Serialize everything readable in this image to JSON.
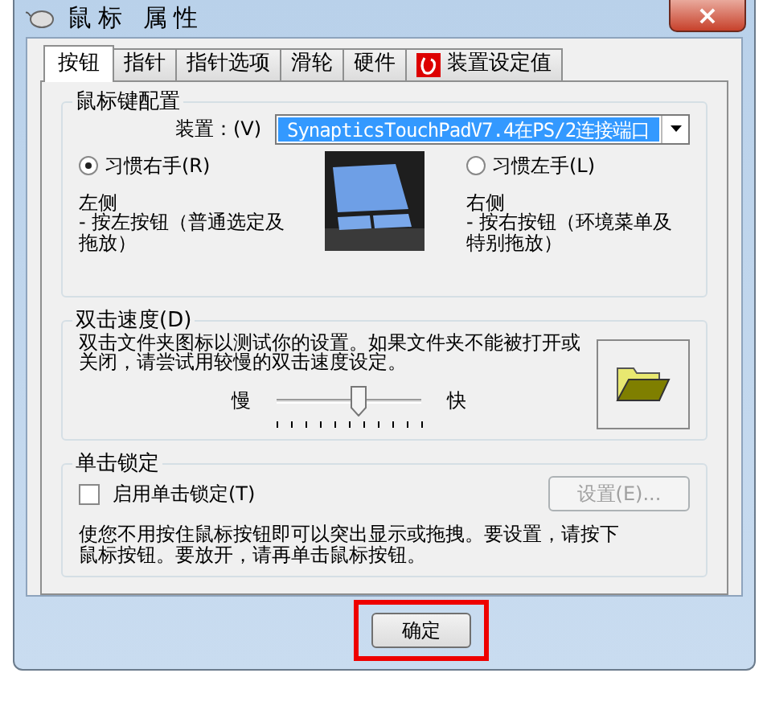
{
  "window": {
    "title": "鼠标 属性",
    "close": "×"
  },
  "tabs": [
    {
      "label": "按钮",
      "selected": true
    },
    {
      "label": "指针",
      "selected": false
    },
    {
      "label": "指针选项",
      "selected": false
    },
    {
      "label": "滑轮",
      "selected": false
    },
    {
      "label": "硬件",
      "selected": false
    },
    {
      "label": "装置设定值",
      "selected": false,
      "kind": "icon"
    }
  ],
  "button_config": {
    "title": "鼠标键配置",
    "device_label": "装置：(V)",
    "device_value": "SynapticsTouchPadV7.4在PS/2连接端口",
    "options": [
      {
        "label": "习惯右手(R)",
        "selected": true,
        "side": "左侧",
        "description": " - 按左按钮（普通选定及拖放）"
      },
      {
        "label": "习惯左手(L)",
        "selected": false,
        "side": "右侧",
        "description": " - 按右按钮（环境菜单及特别拖放）"
      }
    ]
  },
  "double_click": {
    "title": "双击速度(D)",
    "text": "双击文件夹图标以测试你的设置。如果文件夹不能被打开或关闭，请尝试用较慢的双击速度设定。",
    "slow": "慢",
    "fast": "快",
    "level": 0.57
  },
  "click_lock": {
    "title": "单击锁定",
    "checkbox": {
      "label": "启用单击锁定(T)",
      "checked": false
    },
    "settings_button": {
      "label": "设置(E)...",
      "disabled": true
    },
    "text": "使您不用按住鼠标按钮即可以突出显示或拖拽。要设置，请按下鼠标按钮。要放开，请再单击鼠标按钮。"
  },
  "buttons": [
    {
      "label": "确定",
      "highlighted": true
    }
  ]
}
